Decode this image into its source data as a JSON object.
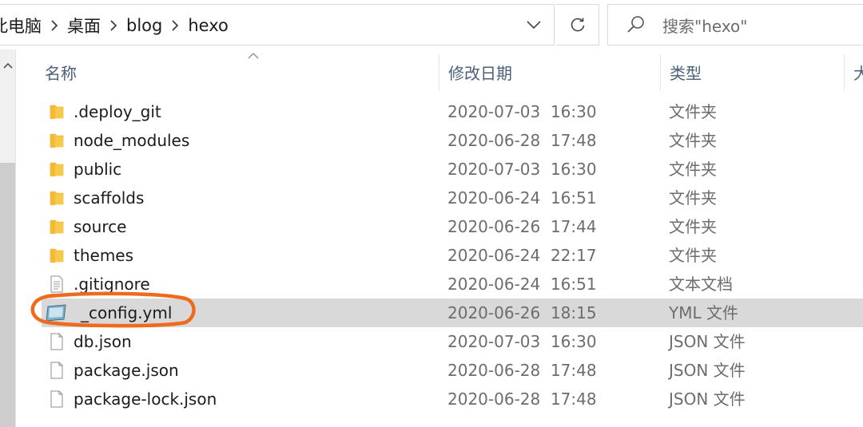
{
  "colors": {
    "highlight": "#f06a1e",
    "selected_row": "#d9d9d9",
    "folder": "#f7c948"
  },
  "address_bar": {
    "breadcrumbs": [
      "此电脑",
      "桌面",
      "blog",
      "hexo"
    ],
    "dropdown_icon": "chevron-down-icon",
    "refresh_icon": "refresh-icon"
  },
  "search": {
    "placeholder": "搜索\"hexo\"",
    "icon": "search-icon"
  },
  "columns": {
    "name": "名称",
    "date": "修改日期",
    "type": "类型",
    "size": "大"
  },
  "files": [
    {
      "name": ".deploy_git",
      "date": "2020-07-03  16:30",
      "type": "文件夹",
      "icon": "folder-icon"
    },
    {
      "name": "node_modules",
      "date": "2020-06-28  17:48",
      "type": "文件夹",
      "icon": "folder-icon"
    },
    {
      "name": "public",
      "date": "2020-07-03  16:30",
      "type": "文件夹",
      "icon": "folder-icon"
    },
    {
      "name": "scaffolds",
      "date": "2020-06-24  16:51",
      "type": "文件夹",
      "icon": "folder-icon"
    },
    {
      "name": "source",
      "date": "2020-06-26  17:44",
      "type": "文件夹",
      "icon": "folder-icon"
    },
    {
      "name": "themes",
      "date": "2020-06-24  22:17",
      "type": "文件夹",
      "icon": "folder-icon"
    },
    {
      "name": ".gitignore",
      "date": "2020-06-24  16:51",
      "type": "文本文档",
      "icon": "text-document-icon"
    },
    {
      "name": "_config.yml",
      "date": "2020-06-26  18:15",
      "type": "YML 文件",
      "icon": "yml-file-icon",
      "selected": true,
      "annotated": true
    },
    {
      "name": "db.json",
      "date": "2020-07-03  16:30",
      "type": "JSON 文件",
      "icon": "file-icon"
    },
    {
      "name": "package.json",
      "date": "2020-06-28  17:48",
      "type": "JSON 文件",
      "icon": "file-icon"
    },
    {
      "name": "package-lock.json",
      "date": "2020-06-28  17:48",
      "type": "JSON 文件",
      "icon": "file-icon"
    }
  ]
}
